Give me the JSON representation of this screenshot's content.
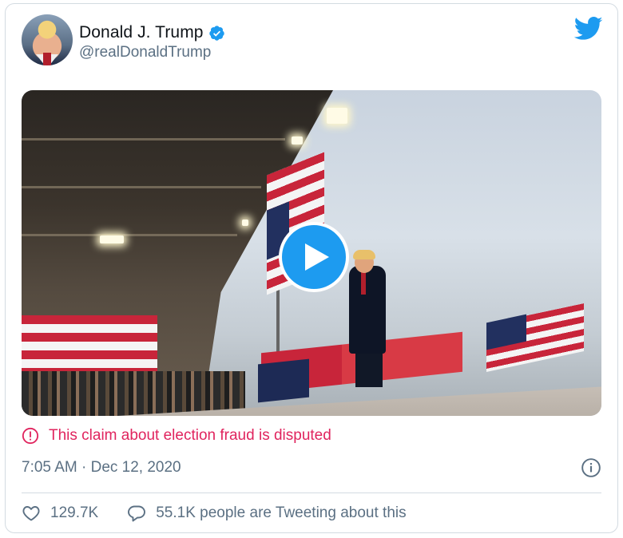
{
  "user": {
    "display_name": "Donald J. Trump",
    "handle": "@realDonaldTrump",
    "verified": true,
    "avatar_icon": "profile-photo"
  },
  "brand": {
    "icon": "twitter-bird-icon",
    "color": "#1d9bf0"
  },
  "media": {
    "type": "video",
    "play_icon": "play-icon"
  },
  "notice": {
    "text": "This claim about election fraud is disputed",
    "icon": "alert-circle-icon",
    "color": "#e0245e"
  },
  "timestamp": "7:05 AM · Dec 12, 2020",
  "info_icon": "info-icon",
  "actions": {
    "likes": "129.7K",
    "like_icon": "heart-icon",
    "conversation": "55.1K people are Tweeting about this",
    "conversation_icon": "reply-bubble-icon"
  },
  "colors": {
    "secondary_text": "#5b7083",
    "border": "#d3dbe1"
  }
}
